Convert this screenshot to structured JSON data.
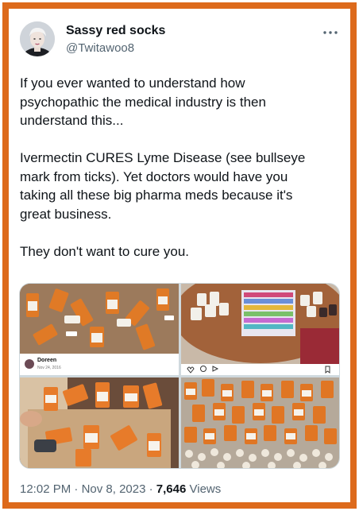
{
  "author": {
    "display_name": "Sassy red socks",
    "handle": "@Twitawoo8",
    "avatar_icon": "profile-photo"
  },
  "more_icon": "more-horizontal-icon",
  "tweet": {
    "paragraphs": [
      "If you ever wanted to understand how\npsychopathic the medical industry is then\nunderstand this...",
      "Ivermectin CURES Lyme Disease (see bullseye\nmark from ticks). Yet doctors would have you\ntaking all these big pharma meds because it's\ngreat business.",
      "They don't want to cure you."
    ]
  },
  "media": {
    "embedded_caption": {
      "name": "Doreen",
      "date": "Nov 24, 2016"
    },
    "embedded_icons": [
      "heart-icon",
      "comment-icon",
      "share-icon",
      "bookmark-icon"
    ]
  },
  "meta": {
    "time": "12:02 PM",
    "separator": " · ",
    "date": "Nov 8, 2023",
    "views_count": "7,646",
    "views_label": " Views"
  },
  "colors": {
    "frame": "#dd6a1c",
    "text": "#0f1419",
    "secondary": "#536471"
  }
}
